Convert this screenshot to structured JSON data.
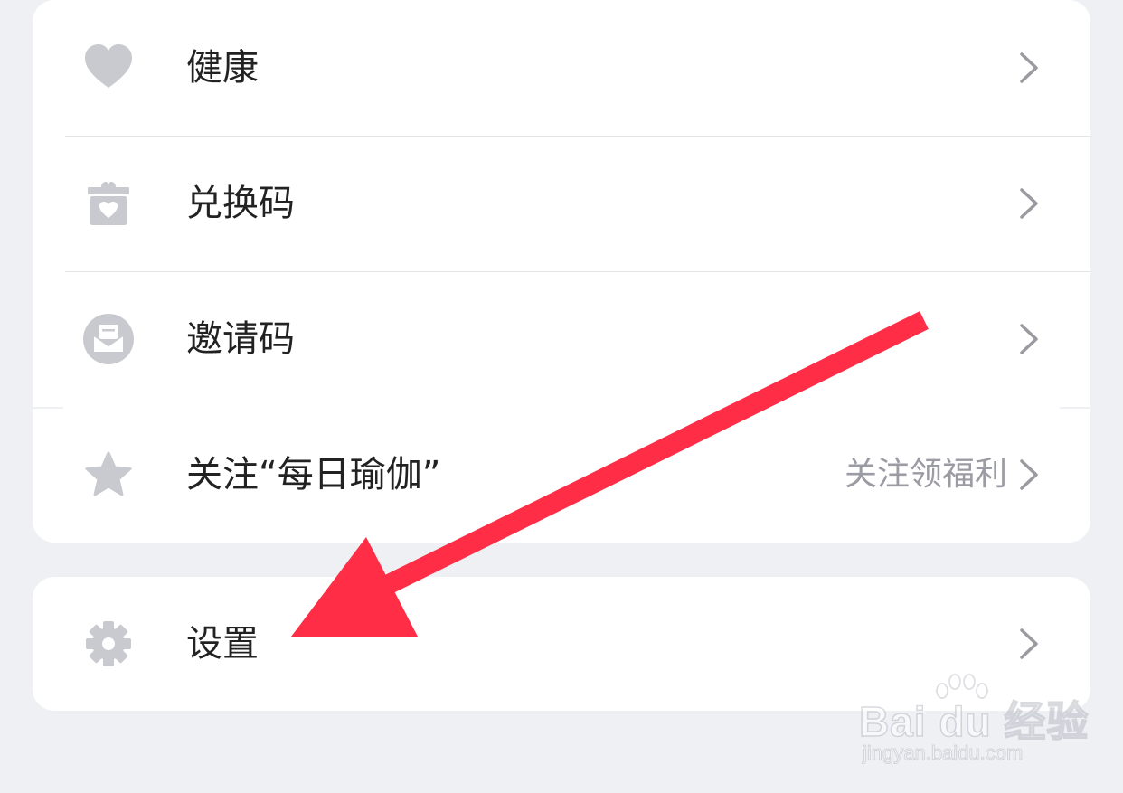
{
  "menu": {
    "items": [
      {
        "label": "健康",
        "icon": "heart-icon"
      },
      {
        "label": "兑换码",
        "icon": "gift-box-icon"
      },
      {
        "label": "邀请码",
        "icon": "envelope-icon"
      },
      {
        "label": "关注“每日瑜伽”",
        "icon": "star-icon",
        "trailing": "关注领福利"
      }
    ]
  },
  "settings": {
    "label": "设置",
    "icon": "gear-icon"
  },
  "annotation": {
    "type": "arrow",
    "color": "#ff2d46"
  },
  "watermark": {
    "brand": "Bai du 经验",
    "url": "jingyan.baidu.com"
  },
  "colors": {
    "background": "#eef0f4",
    "card": "#ffffff",
    "icon": "#c9cacf",
    "text": "#222222",
    "secondary_text": "#9b9ba3",
    "chevron": "#9a9aa0"
  }
}
